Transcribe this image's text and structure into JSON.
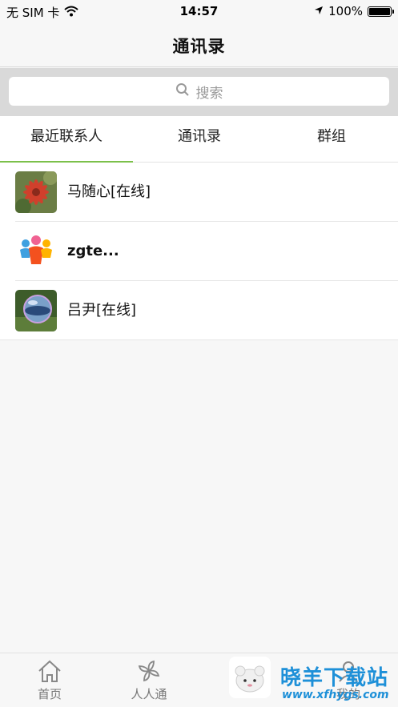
{
  "status_bar": {
    "carrier": "无 SIM 卡",
    "time": "14:57",
    "battery_percent": "100%",
    "battery_level": 1.0
  },
  "header": {
    "title": "通讯录"
  },
  "search": {
    "placeholder": "搜索"
  },
  "tabs": [
    {
      "label": "最近联系人",
      "active": true
    },
    {
      "label": "通讯录",
      "active": false
    },
    {
      "label": "群组",
      "active": false
    }
  ],
  "contacts": [
    {
      "name": "马随心[在线]",
      "avatar": "red-flower-photo"
    },
    {
      "name": "zgte...",
      "avatar": "people-group-logo"
    },
    {
      "name": "吕尹[在线]",
      "avatar": "bubble-photo"
    }
  ],
  "tabbar": {
    "items": [
      {
        "label": "首页",
        "icon": "home-icon"
      },
      {
        "label": "人人通",
        "icon": "pinwheel-icon"
      },
      {
        "label": "",
        "icon": "watermark-sheep-logo"
      },
      {
        "label": "我的",
        "icon": "person-icon"
      }
    ]
  },
  "watermark": {
    "title": "晓羊下载站",
    "url": "www.xfhygs.com"
  },
  "colors": {
    "accent": "#7cc04a",
    "watermark": "#1e90d8"
  }
}
